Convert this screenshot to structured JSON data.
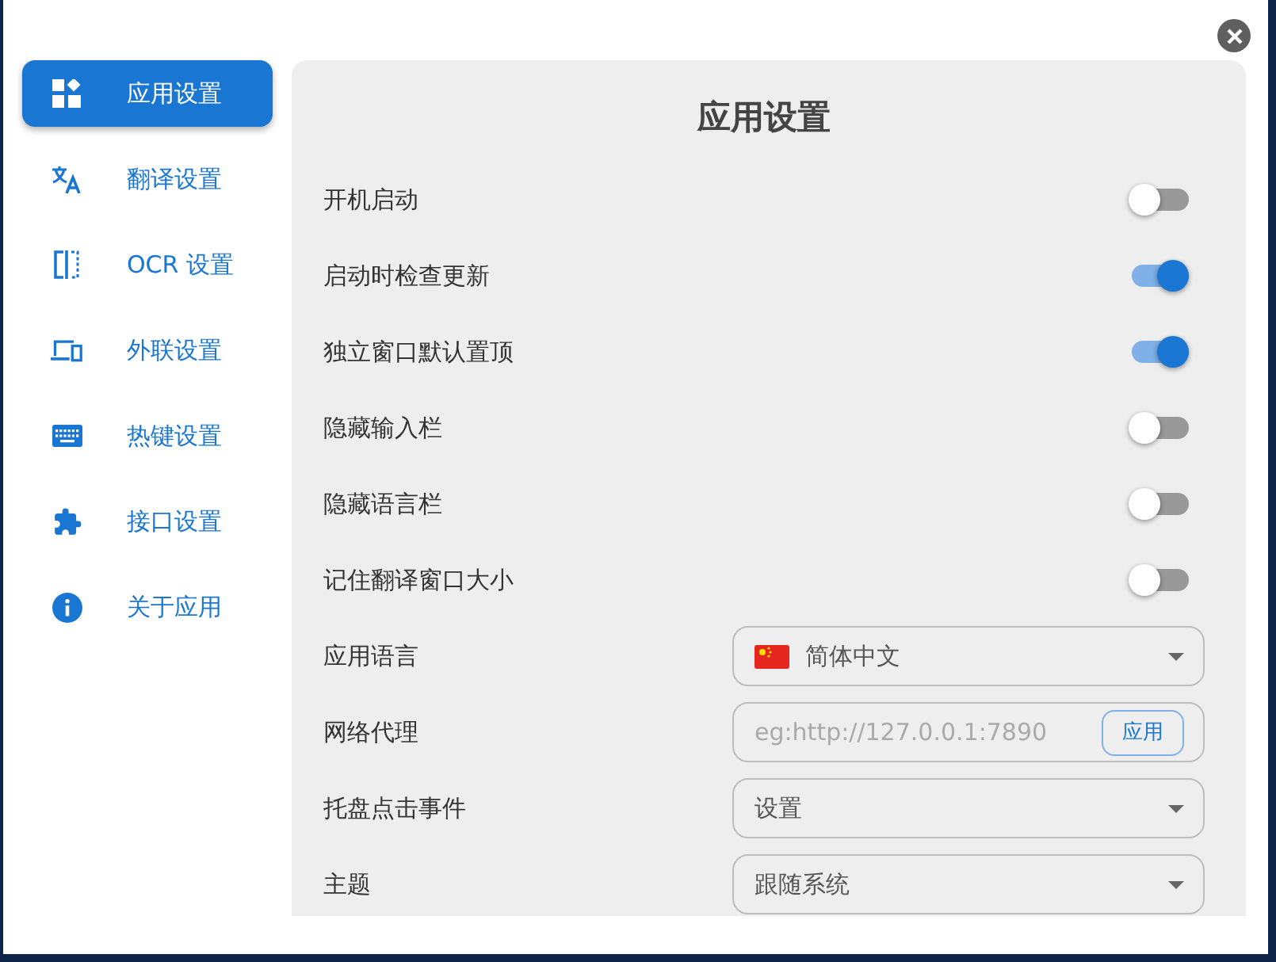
{
  "sidebar": {
    "items": [
      {
        "label": "应用设置",
        "selected": true
      },
      {
        "label": "翻译设置",
        "selected": false
      },
      {
        "label": "OCR 设置",
        "selected": false
      },
      {
        "label": "外联设置",
        "selected": false
      },
      {
        "label": "热键设置",
        "selected": false
      },
      {
        "label": "接口设置",
        "selected": false
      },
      {
        "label": "关于应用",
        "selected": false
      }
    ]
  },
  "panel": {
    "title": "应用设置",
    "settings": [
      {
        "kind": "switch",
        "label": "开机启动",
        "on": false
      },
      {
        "kind": "switch",
        "label": "启动时检查更新",
        "on": true
      },
      {
        "kind": "switch",
        "label": "独立窗口默认置顶",
        "on": true
      },
      {
        "kind": "switch",
        "label": "隐藏输入栏",
        "on": false
      },
      {
        "kind": "switch",
        "label": "隐藏语言栏",
        "on": false
      },
      {
        "kind": "switch",
        "label": "记住翻译窗口大小",
        "on": false
      },
      {
        "kind": "select",
        "label": "应用语言",
        "value": "简体中文",
        "flag": true
      },
      {
        "kind": "input",
        "label": "网络代理",
        "placeholder": "eg:http://127.0.0.1:7890",
        "button": "应用"
      },
      {
        "kind": "select",
        "label": "托盘点击事件",
        "value": "设置"
      },
      {
        "kind": "select",
        "label": "主题",
        "value": "跟随系统"
      }
    ]
  }
}
